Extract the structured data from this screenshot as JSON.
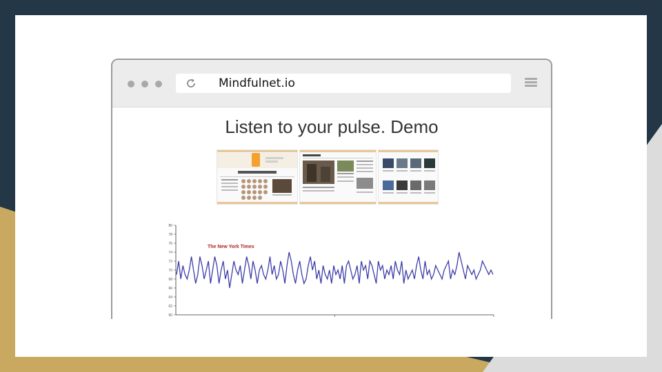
{
  "colors": {
    "navy": "#233746",
    "gold": "#c9a95f",
    "light_gray": "#dcdcdc",
    "line": "#3c3ca8",
    "chart_title": "#b22222"
  },
  "browser": {
    "url": "Mindfulnet.io",
    "icons": [
      "reload-icon",
      "hamburger-menu-icon"
    ]
  },
  "page": {
    "heading": "Listen to your pulse. Demo",
    "thumbnails": [
      "nyt-homepage",
      "news-homepage",
      "image-grid-page"
    ]
  },
  "chart_data": {
    "type": "line",
    "title": "The New York Times",
    "ylim": [
      60,
      80
    ],
    "y_ticks": [
      "80",
      "78",
      "76",
      "74",
      "72",
      "70",
      "68",
      "66",
      "64",
      "62",
      "60"
    ],
    "series": [
      {
        "values": [
          69,
          72,
          68,
          71,
          69,
          68,
          70,
          73,
          70,
          67,
          69,
          73,
          71,
          68,
          70,
          72,
          67,
          70,
          73,
          71,
          67,
          70,
          72,
          68,
          70,
          66,
          69,
          72,
          70,
          69,
          71,
          67,
          70,
          73,
          71,
          68,
          72,
          70,
          67,
          70,
          71,
          69,
          68,
          70,
          73,
          69,
          71,
          68,
          69,
          72,
          70,
          67,
          71,
          74,
          72,
          69,
          67,
          70,
          72,
          69,
          67,
          68,
          71,
          73,
          70,
          72,
          68,
          70,
          67,
          71,
          69,
          68,
          70,
          67,
          71,
          69,
          70,
          68,
          71,
          67,
          71,
          72,
          70,
          68,
          69,
          71,
          67,
          72,
          70,
          71,
          68,
          72,
          71,
          69,
          67,
          72,
          70,
          71,
          68,
          70,
          69,
          71,
          68,
          72,
          70,
          69,
          72,
          67,
          70,
          68,
          69,
          70,
          68,
          71,
          73,
          70,
          68,
          72,
          69,
          70,
          68,
          69,
          71,
          70,
          69,
          68,
          70,
          71,
          72,
          68,
          70,
          69,
          71,
          74,
          72,
          70,
          68,
          71,
          70,
          69,
          70,
          68,
          69,
          70,
          72,
          71,
          70,
          69,
          70,
          69
        ]
      }
    ]
  }
}
